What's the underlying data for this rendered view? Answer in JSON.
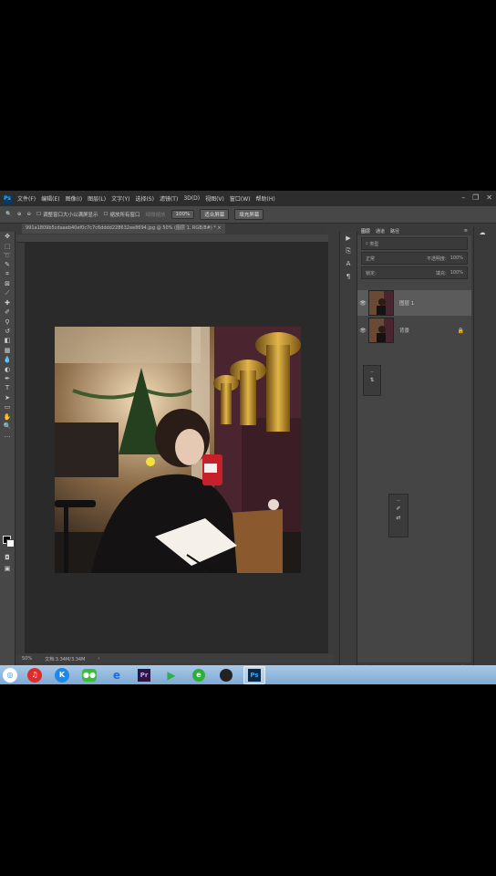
{
  "app": {
    "name": "Ps"
  },
  "menu": {
    "items": [
      "文件(F)",
      "编辑(E)",
      "图像(I)",
      "图层(L)",
      "文字(Y)",
      "选择(S)",
      "滤镜(T)",
      "3D(D)",
      "视图(V)",
      "窗口(W)",
      "帮助(H)"
    ]
  },
  "options_bar": {
    "resize_label": "调整窗口大小以满屏显示",
    "zoom_all_label": "缩放所有窗口",
    "scrubby_label": "细微缩放",
    "zoom_value": "100%",
    "fit_screen": "适合屏幕",
    "fill_screen": "填充屏幕"
  },
  "document": {
    "tab_title": "991a1809b5cdaaeb40ef0c7c7c6dddd228632ee8694.jpg @ 50% (图层 1, RGB/8#) *",
    "zoom": "50%",
    "doc_info": "文档:3.34M/3.34M"
  },
  "layers_panel": {
    "tabs": [
      "图层",
      "通道",
      "路径"
    ],
    "kind_label": "类型",
    "blend_mode": "正常",
    "opacity_label": "不透明度:",
    "opacity_value": "100%",
    "lock_label": "锁定:",
    "fill_label": "填充:",
    "fill_value": "100%",
    "layers": [
      {
        "name": "图层 1",
        "selected": true
      },
      {
        "name": "背景",
        "selected": false,
        "locked": true
      }
    ]
  },
  "taskbar": {
    "apps": [
      "360-icon",
      "netease-music-icon",
      "kugou-icon",
      "wechat-icon",
      "ie-icon",
      "premiere-icon",
      "video-icon",
      "browser-icon",
      "photo-icon",
      "photoshop-icon"
    ],
    "labels": {
      "premiere": "Pr",
      "photoshop": "Ps"
    }
  },
  "colors": {
    "ps_accent": "#31a8ff",
    "panel_bg": "#454545",
    "canvas_bg": "#2a2a2a"
  }
}
